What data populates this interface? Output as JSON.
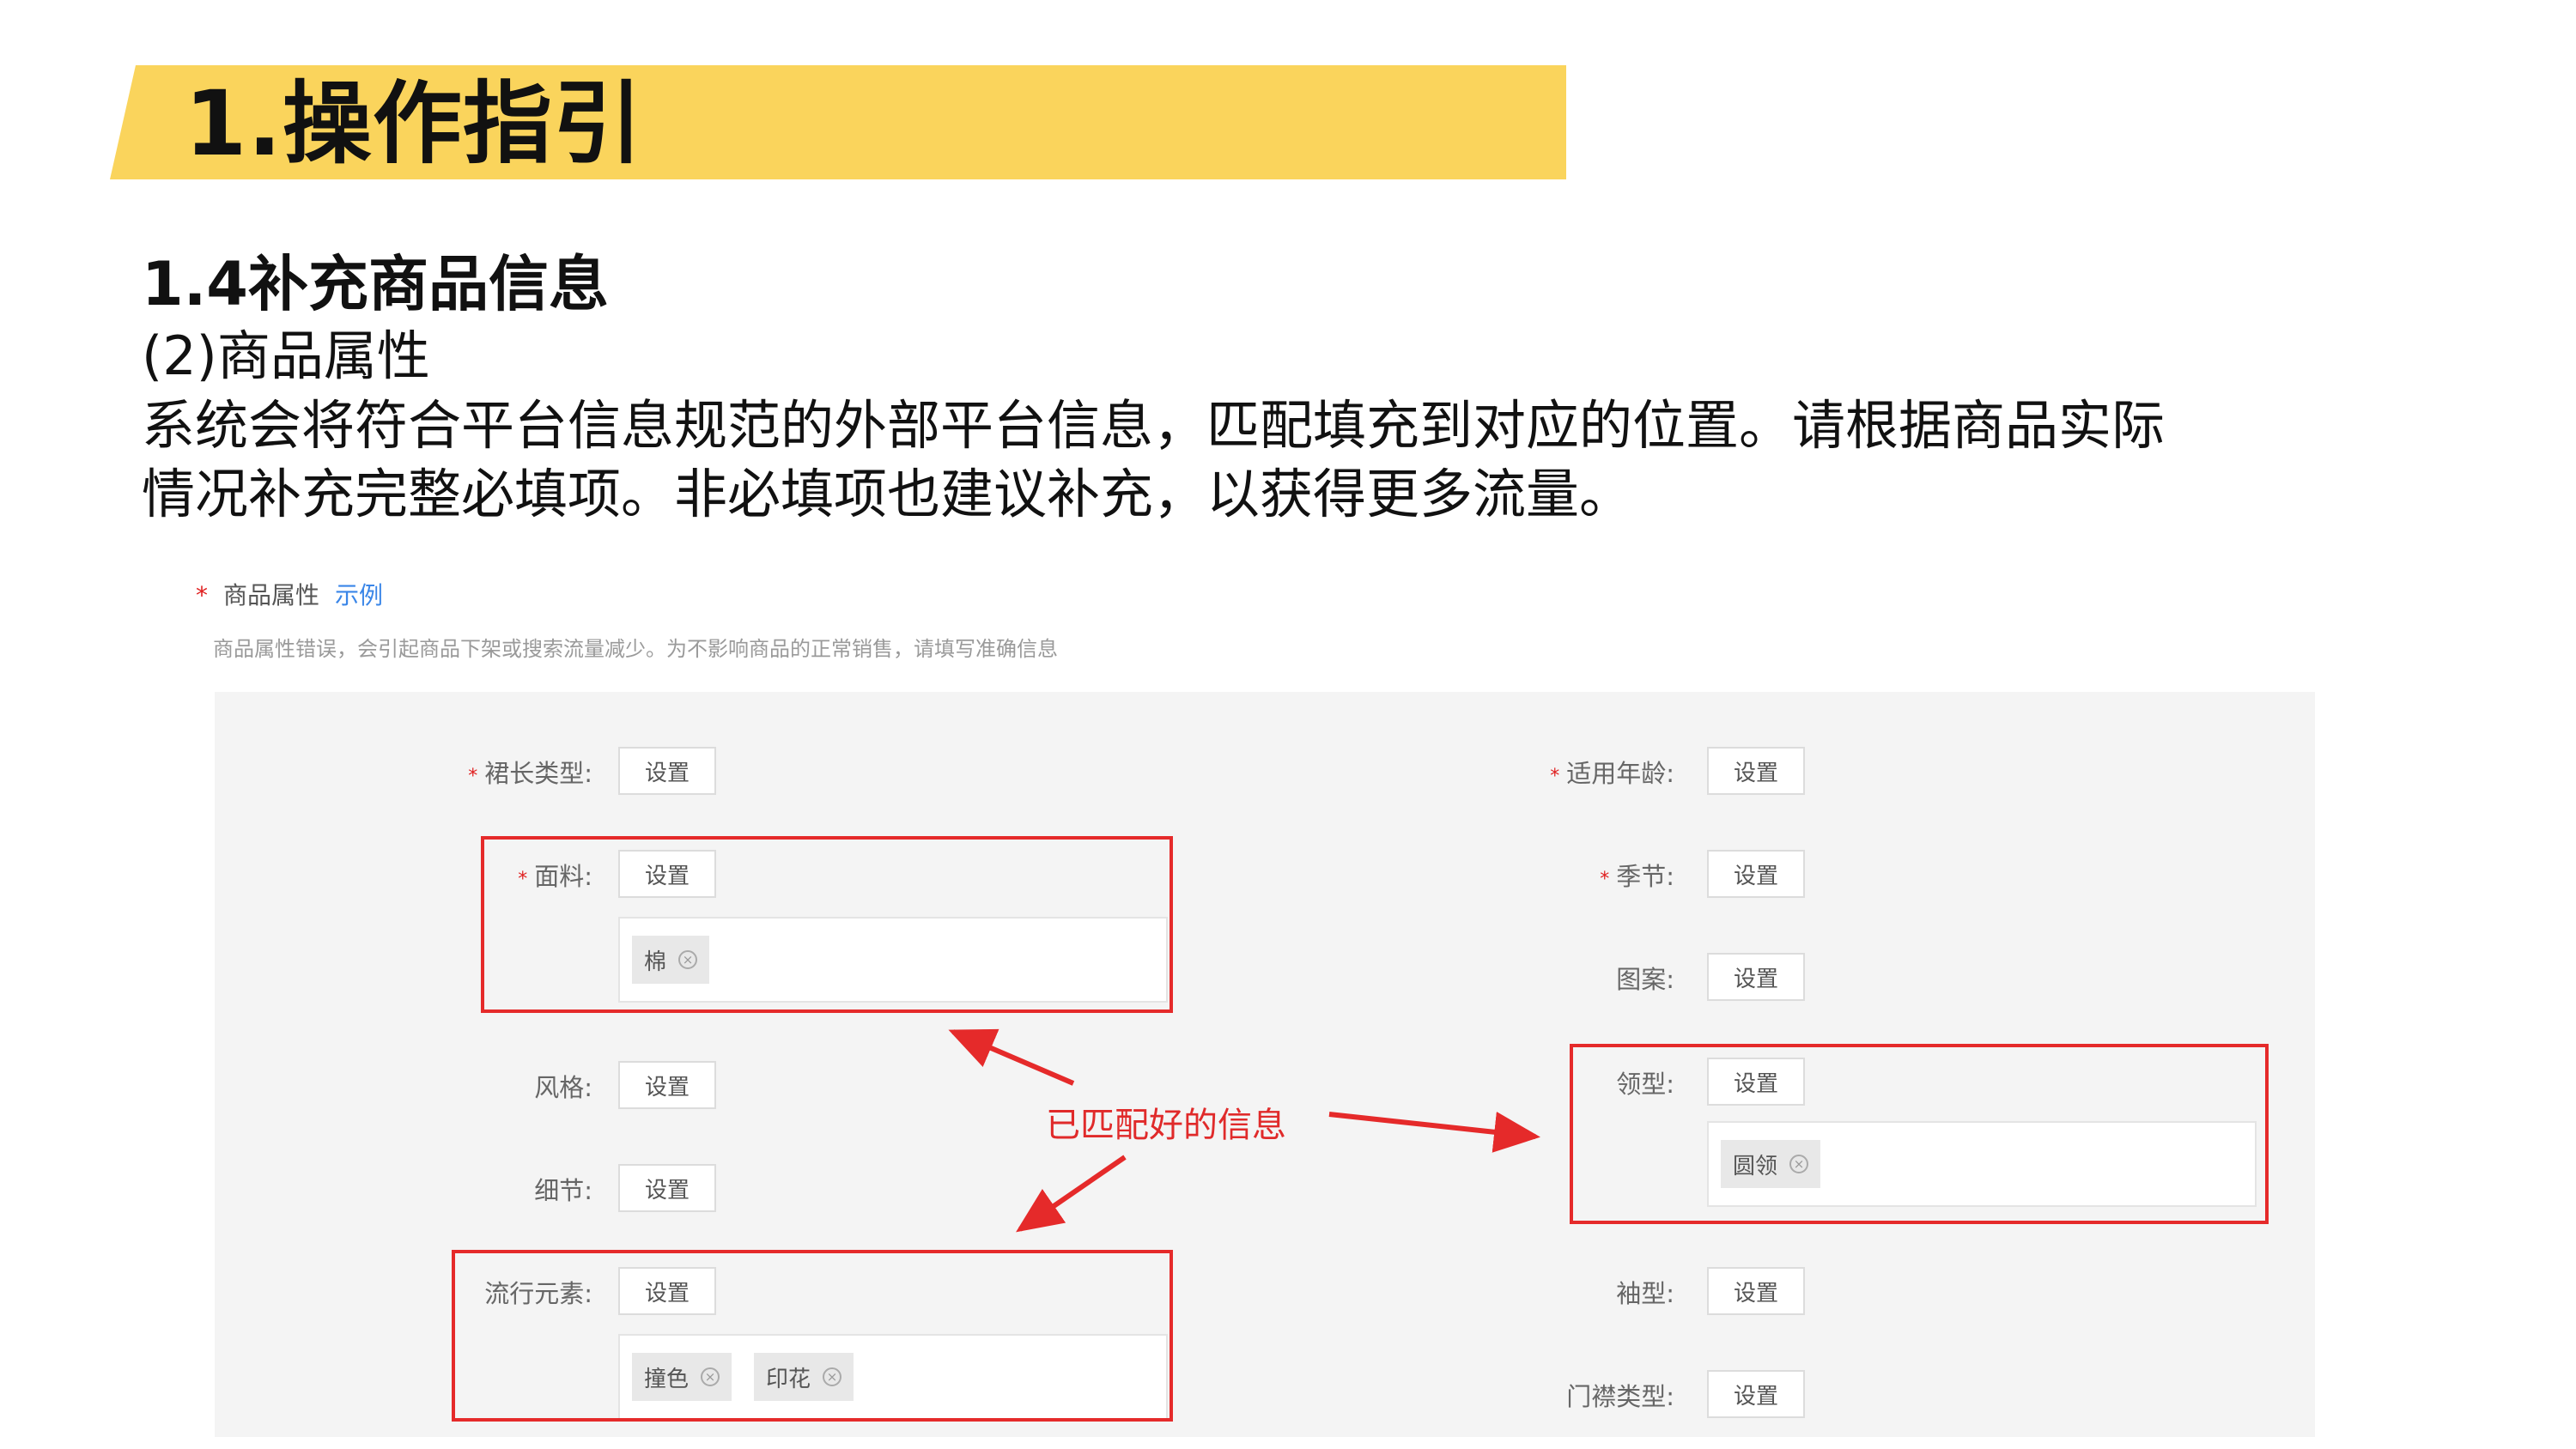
{
  "header": {
    "title": "1.操作指引"
  },
  "section": {
    "title": "1.4补充商品信息",
    "subtitle": "(2)商品属性",
    "desc_line1": "系统会将符合平台信息规范的外部平台信息，匹配填充到对应的位置。请根据商品实际",
    "desc_line2": "情况补充完整必填项。非必填项也建议补充，以获得更多流量。"
  },
  "screenshot": {
    "required_mark": "*",
    "label": "商品属性",
    "example_link": "示例",
    "note": "商品属性错误，会引起商品下架或搜索流量减少。为不影响商品的正常销售，请填写准确信息",
    "button_label": "设置",
    "remove_icon": "×",
    "left_fields": [
      {
        "label": "裙长类型:",
        "required": true
      },
      {
        "label": "面料:",
        "required": true,
        "tags": [
          "棉"
        ]
      },
      {
        "label": "风格:",
        "required": false
      },
      {
        "label": "细节:",
        "required": false
      },
      {
        "label": "流行元素:",
        "required": false,
        "tags": [
          "撞色",
          "印花"
        ]
      }
    ],
    "right_fields": [
      {
        "label": "适用年龄:",
        "required": true
      },
      {
        "label": "季节:",
        "required": true
      },
      {
        "label": "图案:",
        "required": false
      },
      {
        "label": "领型:",
        "required": false,
        "tags": [
          "圆领"
        ]
      },
      {
        "label": "袖型:",
        "required": false
      },
      {
        "label": "门襟类型:",
        "required": false
      }
    ],
    "annotation": "已匹配好的信息",
    "annotation_color": "#e02a2a"
  },
  "colors": {
    "banner": "#fad45c",
    "highlight_box": "#e52a2a",
    "link": "#3a86e8"
  }
}
